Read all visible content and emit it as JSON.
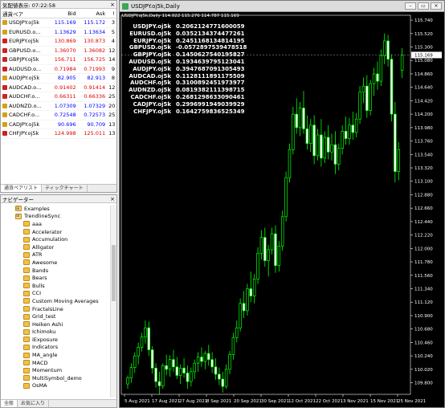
{
  "market_watch": {
    "title": "気配値表示: 07:22:58",
    "close": "×",
    "headers": {
      "symbol": "通貨ペア",
      "bid": "Bid",
      "ask": "Ask",
      "spread": "!"
    },
    "rows": [
      {
        "symbol": "USDJPY.oj5k",
        "bid": "115.169",
        "ask": "115.172",
        "spread": "3",
        "bid_color": "blue",
        "ask_color": "blue",
        "icon_color": "#d4a017"
      },
      {
        "symbol": "EURUSD.o...",
        "bid": "1.13629",
        "ask": "1.13634",
        "spread": "5",
        "bid_color": "blue",
        "ask_color": "blue",
        "icon_color": "#d4a017"
      },
      {
        "symbol": "EURJPY.oj5k",
        "bid": "130.869",
        "ask": "130.873",
        "spread": "4",
        "bid_color": "red",
        "ask_color": "red",
        "icon_color": "#cc2222"
      },
      {
        "symbol": "GBPUSD.o...",
        "bid": "1.36070",
        "ask": "1.36082",
        "spread": "12",
        "bid_color": "red",
        "ask_color": "red",
        "icon_color": "#cc2222"
      },
      {
        "symbol": "GBPJPY.oj5k",
        "bid": "156.711",
        "ask": "156.725",
        "spread": "14",
        "bid_color": "red",
        "ask_color": "red",
        "icon_color": "#cc2222"
      },
      {
        "symbol": "AUDUSD.o...",
        "bid": "0.71984",
        "ask": "0.71993",
        "spread": "9",
        "bid_color": "red",
        "ask_color": "red",
        "icon_color": "#cc2222"
      },
      {
        "symbol": "AUDJPY.oj5k",
        "bid": "82.905",
        "ask": "82.913",
        "spread": "8",
        "bid_color": "blue",
        "ask_color": "blue",
        "icon_color": "#d4a017"
      },
      {
        "symbol": "AUDCAD.o...",
        "bid": "0.91402",
        "ask": "0.91414",
        "spread": "12",
        "bid_color": "red",
        "ask_color": "red",
        "icon_color": "#cc2222"
      },
      {
        "symbol": "AUDCHF.o...",
        "bid": "0.66311",
        "ask": "0.66336",
        "spread": "25",
        "bid_color": "red",
        "ask_color": "red",
        "icon_color": "#cc2222"
      },
      {
        "symbol": "AUDNZD.o...",
        "bid": "1.07309",
        "ask": "1.07329",
        "spread": "20",
        "bid_color": "blue",
        "ask_color": "blue",
        "icon_color": "#d4a017"
      },
      {
        "symbol": "CADCHF.o...",
        "bid": "0.72548",
        "ask": "0.72573",
        "spread": "25",
        "bid_color": "blue",
        "ask_color": "blue",
        "icon_color": "#d4a017"
      },
      {
        "symbol": "CADJPY.oj5k",
        "bid": "90.696",
        "ask": "90.709",
        "spread": "13",
        "bid_color": "blue",
        "ask_color": "blue",
        "icon_color": "#d4a017"
      },
      {
        "symbol": "CHFJPY.oj5k",
        "bid": "124.998",
        "ask": "125.011",
        "spread": "13",
        "bid_color": "red",
        "ask_color": "red",
        "icon_color": "#cc2222"
      }
    ],
    "tabs": [
      "通貨ペアリスト",
      "ティックチャート"
    ]
  },
  "navigator": {
    "title": "ナビゲーター",
    "close": "×",
    "items": [
      {
        "label": "Examples",
        "folder": true
      },
      {
        "label": "TrendlineSync",
        "folder": true
      },
      {
        "label": "aaa",
        "folder": false
      },
      {
        "label": "Accelerator",
        "folder": false
      },
      {
        "label": "Accumulation",
        "folder": false
      },
      {
        "label": "Alligator",
        "folder": false
      },
      {
        "label": "ATR",
        "folder": false
      },
      {
        "label": "Awesome",
        "folder": false
      },
      {
        "label": "Bands",
        "folder": false
      },
      {
        "label": "Bears",
        "folder": false
      },
      {
        "label": "Bulls",
        "folder": false
      },
      {
        "label": "CCI",
        "folder": false
      },
      {
        "label": "Custom Moving Averages",
        "folder": false
      },
      {
        "label": "FractalsLine",
        "folder": false
      },
      {
        "label": "Grid_test",
        "folder": false
      },
      {
        "label": "Heiken Ashi",
        "folder": false
      },
      {
        "label": "Ichimoku",
        "folder": false
      },
      {
        "label": "iExposure",
        "folder": false
      },
      {
        "label": "Indicators",
        "folder": false
      },
      {
        "label": "MA_angle",
        "folder": false
      },
      {
        "label": "MACD",
        "folder": false
      },
      {
        "label": "Momentum",
        "folder": false
      },
      {
        "label": "MultiSymbol_demo",
        "folder": false
      },
      {
        "label": "OsMA",
        "folder": false
      }
    ],
    "tabs": [
      "全般",
      "お気に入り"
    ]
  },
  "chart_window": {
    "title": "USDJPY.oj5k,Daily",
    "info_line": "USDJPY.oj5k,Daily  114.922 115.276 114.787 115.169",
    "buttons": [
      "–",
      "▭",
      "×"
    ],
    "correlations": [
      {
        "symbol": "USDJPY.oj5k",
        "value": "0.2062124771600059"
      },
      {
        "symbol": "EURUSD.oj5k",
        "value": "0.0352134374477261"
      },
      {
        "symbol": "EURJPY.oj5k",
        "value": "0.2451168134814195"
      },
      {
        "symbol": "GBPUSD.oj5k",
        "value": "-0.0572897539478518"
      },
      {
        "symbol": "GBPJPY.oj5k",
        "value": "0.1450627540195827"
      },
      {
        "symbol": "AUDUSD.oj5k",
        "value": "0.1934639795123041"
      },
      {
        "symbol": "AUDJPY.oj5k",
        "value": "0.3947687091305493"
      },
      {
        "symbol": "AUDCAD.oj5k",
        "value": "0.1128111891175509"
      },
      {
        "symbol": "AUDCHF.oj5k",
        "value": "0.3100892451973977"
      },
      {
        "symbol": "AUDNZD.oj5k",
        "value": "0.0819382111398715"
      },
      {
        "symbol": "CADCHF.oj5k",
        "value": "0.2681298633090461"
      },
      {
        "symbol": "CADJPY.oj5k",
        "value": "0.2996991949039929"
      },
      {
        "symbol": "CHFJPY.oj5k",
        "value": "0.1642759836525349"
      }
    ]
  },
  "chart_data": {
    "type": "candlestick",
    "symbol": "USDJPY.oj5k",
    "timeframe": "Daily",
    "ylim": [
      109.61,
      115.82
    ],
    "y_ticks": [
      "115.740",
      "115.520",
      "115.300",
      "115.080",
      "114.860",
      "114.640",
      "114.420",
      "114.200",
      "113.980",
      "113.760",
      "113.540",
      "113.320",
      "113.100",
      "112.880",
      "112.660",
      "112.440",
      "112.220",
      "112.000",
      "111.780",
      "111.560",
      "111.340",
      "111.120",
      "110.900",
      "110.680",
      "110.460",
      "110.240",
      "110.020",
      "109.800"
    ],
    "x_labels": [
      "5 Aug 2021",
      "17 Aug 2021",
      "27 Aug 2021",
      "8 Sep 2021",
      "20 Sep 2021",
      "30 Sep 2021",
      "12 Oct 2021",
      "22 Oct 2021",
      "3 Nov 2021",
      "15 Nov 2021",
      "25 Nov 2021"
    ],
    "current_price": "115.169",
    "candles": [
      [
        109.78,
        109.92,
        109.7,
        109.88
      ],
      [
        109.88,
        110.12,
        109.8,
        110.05
      ],
      [
        110.05,
        110.3,
        109.96,
        110.24
      ],
      [
        110.24,
        110.46,
        110.1,
        110.38
      ],
      [
        110.38,
        110.62,
        110.31,
        110.55
      ],
      [
        110.55,
        110.82,
        110.44,
        110.7
      ],
      [
        110.7,
        110.8,
        110.24,
        110.34
      ],
      [
        110.34,
        110.4,
        109.95,
        110.04
      ],
      [
        110.04,
        110.12,
        109.72,
        109.82
      ],
      [
        109.82,
        109.98,
        109.6,
        109.75
      ],
      [
        109.75,
        110.12,
        109.7,
        110.08
      ],
      [
        110.08,
        110.26,
        109.92,
        110.02
      ],
      [
        110.02,
        110.25,
        109.9,
        110.18
      ],
      [
        110.18,
        110.34,
        109.98,
        110.06
      ],
      [
        110.06,
        110.22,
        109.86,
        109.92
      ],
      [
        109.92,
        110.1,
        109.78,
        110.04
      ],
      [
        110.04,
        110.2,
        109.88,
        109.96
      ],
      [
        109.96,
        110.08,
        109.7,
        109.82
      ],
      [
        109.82,
        110.05,
        109.74,
        109.98
      ],
      [
        109.98,
        110.18,
        109.86,
        110.12
      ],
      [
        110.12,
        110.3,
        109.98,
        110.22
      ],
      [
        110.22,
        110.38,
        110.06,
        110.15
      ],
      [
        110.15,
        110.32,
        110.02,
        110.28
      ],
      [
        110.28,
        110.42,
        110.08,
        110.18
      ],
      [
        110.18,
        110.3,
        109.96,
        110.06
      ],
      [
        110.06,
        110.2,
        109.85,
        109.94
      ],
      [
        109.94,
        110.05,
        109.76,
        109.86
      ],
      [
        109.86,
        109.98,
        109.64,
        109.74
      ],
      [
        109.74,
        110.1,
        109.7,
        110.02
      ],
      [
        110.02,
        110.32,
        109.94,
        110.26
      ],
      [
        110.26,
        110.62,
        110.18,
        110.54
      ],
      [
        110.54,
        110.82,
        110.46,
        110.7
      ],
      [
        110.7,
        111.18,
        110.64,
        111.1
      ],
      [
        111.1,
        111.3,
        110.86,
        110.98
      ],
      [
        110.98,
        111.42,
        110.9,
        111.34
      ],
      [
        111.34,
        111.62,
        111.12,
        111.22
      ],
      [
        111.22,
        111.58,
        111.1,
        111.5
      ],
      [
        111.5,
        112.02,
        111.42,
        111.92
      ],
      [
        111.92,
        112.3,
        111.82,
        112.18
      ],
      [
        112.18,
        112.34,
        111.7,
        111.8
      ],
      [
        111.8,
        112.06,
        111.54,
        111.98
      ],
      [
        111.98,
        112.34,
        111.9,
        112.24
      ],
      [
        112.24,
        112.38,
        111.6,
        111.72
      ],
      [
        111.72,
        112.12,
        111.62,
        112.04
      ],
      [
        112.04,
        112.62,
        111.96,
        112.52
      ],
      [
        112.52,
        113.26,
        112.44,
        113.16
      ],
      [
        113.16,
        113.72,
        113.08,
        113.62
      ],
      [
        113.62,
        114.32,
        113.54,
        114.2
      ],
      [
        114.2,
        114.46,
        113.88,
        113.98
      ],
      [
        113.98,
        114.4,
        113.84,
        114.3
      ],
      [
        114.3,
        114.58,
        113.88,
        113.96
      ],
      [
        113.96,
        114.18,
        113.62,
        113.72
      ],
      [
        113.72,
        114.12,
        113.58,
        114.02
      ],
      [
        114.02,
        114.18,
        113.38,
        113.52
      ],
      [
        113.52,
        113.96,
        113.44,
        113.86
      ],
      [
        113.86,
        114.12,
        113.34,
        113.48
      ],
      [
        113.48,
        113.92,
        113.4,
        113.82
      ],
      [
        113.82,
        114.02,
        113.46,
        113.58
      ],
      [
        113.58,
        113.88,
        113.44,
        113.7
      ],
      [
        113.7,
        113.92,
        113.22,
        113.38
      ],
      [
        113.38,
        113.72,
        113.28,
        113.64
      ],
      [
        113.64,
        114.02,
        113.54,
        113.92
      ],
      [
        113.92,
        114.16,
        113.7,
        113.8
      ],
      [
        113.8,
        114.14,
        113.7,
        114.02
      ],
      [
        114.02,
        114.24,
        113.78,
        113.9
      ],
      [
        113.9,
        114.22,
        113.82,
        114.12
      ],
      [
        114.12,
        114.66,
        114.04,
        114.56
      ],
      [
        114.56,
        114.8,
        114.38,
        114.66
      ],
      [
        114.66,
        114.84,
        114.14,
        114.26
      ],
      [
        114.26,
        114.76,
        114.18,
        114.7
      ],
      [
        114.7,
        114.96,
        114.5,
        114.86
      ],
      [
        114.86,
        115.06,
        114.6,
        114.74
      ],
      [
        114.74,
        115.26,
        114.66,
        115.16
      ],
      [
        115.16,
        115.52,
        115.02,
        115.4
      ],
      [
        115.4,
        115.5,
        114.98,
        115.1
      ],
      [
        115.1,
        115.18,
        114.08,
        114.2
      ],
      [
        114.2,
        114.4,
        113.08,
        113.26
      ],
      [
        113.26,
        113.74,
        113.12,
        113.62
      ],
      [
        114.92,
        115.28,
        114.79,
        115.17
      ]
    ]
  }
}
